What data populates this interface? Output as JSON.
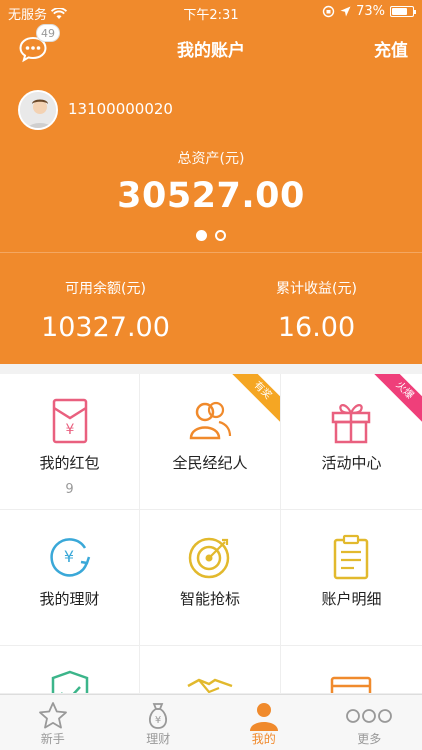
{
  "status_bar": {
    "carrier": "无服务",
    "time": "下午2:31",
    "battery_percent": "73%",
    "battery_level": 0.73
  },
  "header": {
    "title": "我的账户",
    "recharge_label": "充值",
    "message_badge": "49"
  },
  "account": {
    "phone": "13100000020",
    "total_assets_label": "总资产(元)",
    "total_assets": "30527.00",
    "carousel_pages": 2,
    "carousel_active": 0,
    "available_label": "可用余额(元)",
    "available": "10327.00",
    "earnings_label": "累计收益(元)",
    "earnings": "16.00"
  },
  "grid": [
    {
      "label": "我的红包",
      "sub": "9",
      "icon": "red-envelope-icon",
      "color": "#e9607f"
    },
    {
      "label": "全民经纪人",
      "sub": "",
      "icon": "people-icon",
      "color": "#f08a2c",
      "ribbon": "有奖",
      "ribbon_color": "#f5a623"
    },
    {
      "label": "活动中心",
      "sub": "",
      "icon": "gift-icon",
      "color": "#e9607f",
      "ribbon": "火爆",
      "ribbon_color": "#ef3f7a"
    },
    {
      "label": "我的理财",
      "sub": "",
      "icon": "yen-circle-icon",
      "color": "#3aa8d8"
    },
    {
      "label": "智能抢标",
      "sub": "",
      "icon": "target-icon",
      "color": "#e2b92d"
    },
    {
      "label": "账户明细",
      "sub": "",
      "icon": "clipboard-icon",
      "color": "#e2b92d"
    },
    {
      "label": "",
      "sub": "",
      "icon": "shield-check-icon",
      "color": "#3cb58a"
    },
    {
      "label": "",
      "sub": "",
      "icon": "handshake-icon",
      "color": "#e2b92d"
    },
    {
      "label": "",
      "sub": "",
      "icon": "card-icon",
      "color": "#f08a2c"
    }
  ],
  "tabbar": [
    {
      "label": "新手",
      "icon": "star-icon",
      "active": false
    },
    {
      "label": "理财",
      "icon": "money-bag-icon",
      "active": false
    },
    {
      "label": "我的",
      "icon": "user-icon",
      "active": true
    },
    {
      "label": "更多",
      "icon": "more-icon",
      "active": false
    }
  ],
  "colors": {
    "brand": "#f08a2c",
    "inactive": "#999999"
  }
}
